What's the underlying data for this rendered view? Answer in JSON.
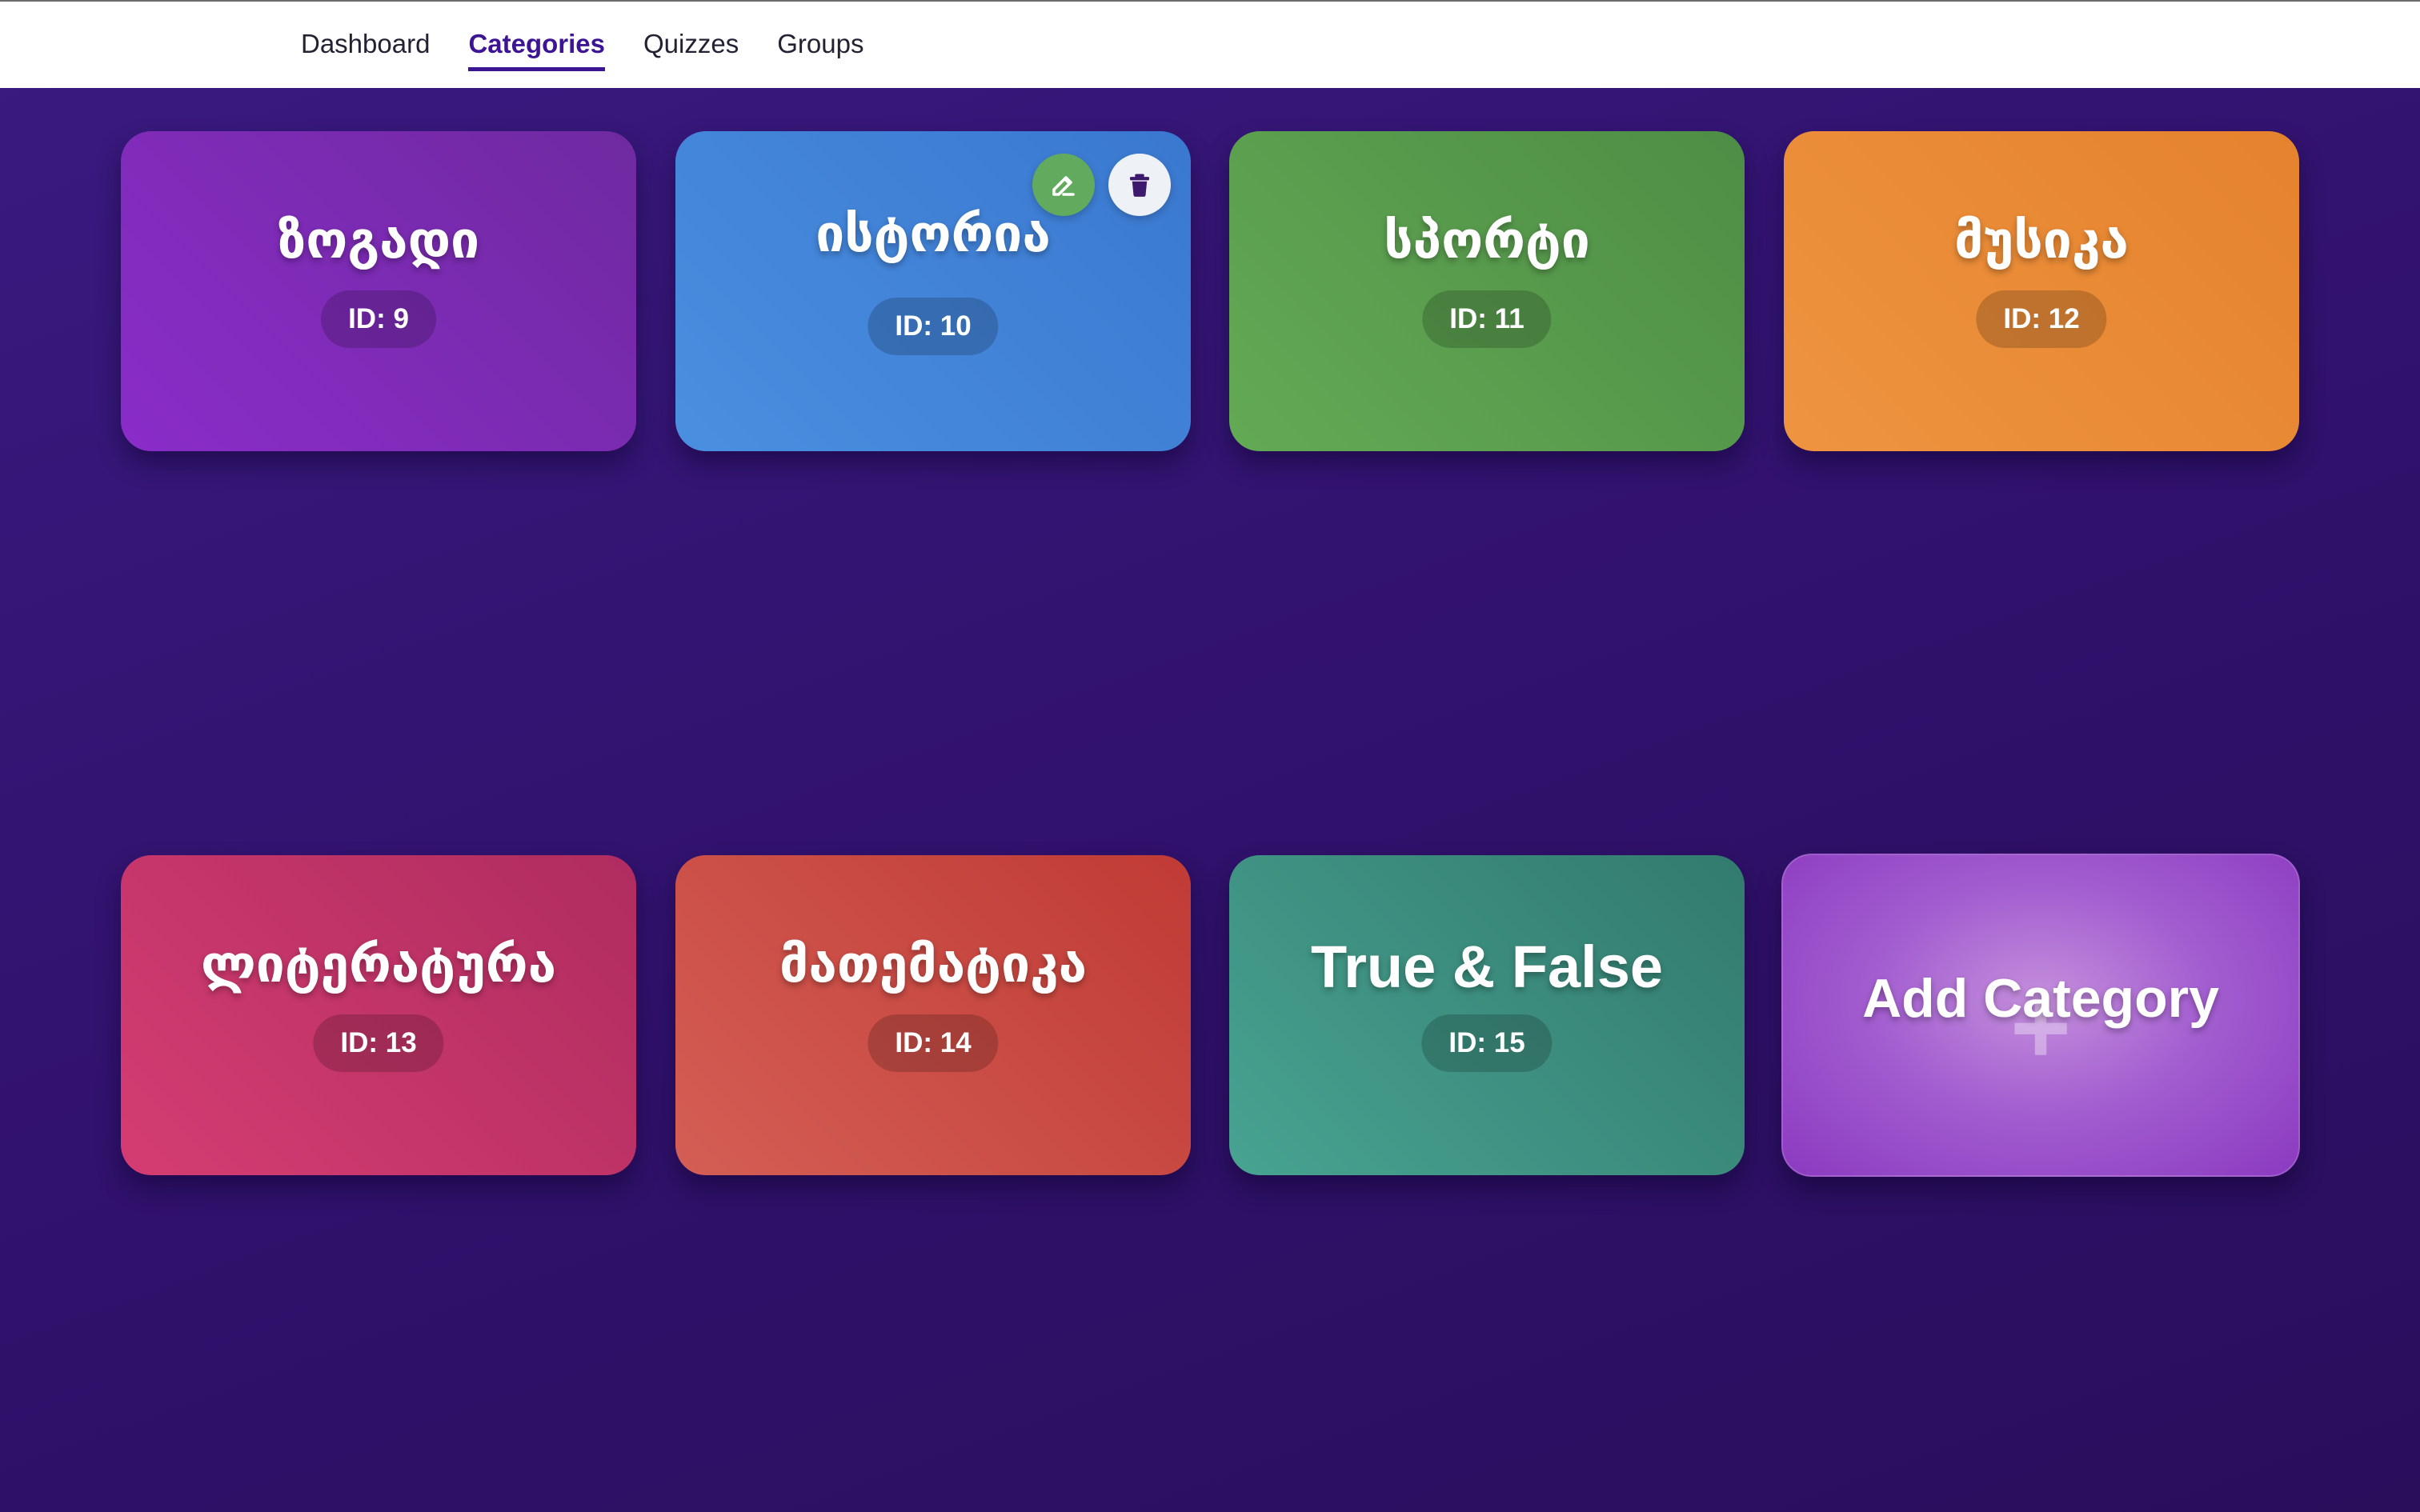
{
  "nav": {
    "items": [
      {
        "label": "Dashboard"
      },
      {
        "label": "Categories"
      },
      {
        "label": "Quizzes"
      },
      {
        "label": "Groups"
      }
    ],
    "active": "Categories"
  },
  "categories": [
    {
      "name": "ზოგადი",
      "id_label": "ID: 9",
      "color_start": "#8a2cc9",
      "color_end": "#6f2aa0"
    },
    {
      "name": "ისტორია",
      "id_label": "ID: 10",
      "color_start": "#4a8fe0",
      "color_end": "#3a78d0"
    },
    {
      "name": "სპორტი",
      "id_label": "ID: 11",
      "color_start": "#63aa55",
      "color_end": "#4e8d45"
    },
    {
      "name": "მუსიკა",
      "id_label": "ID: 12",
      "color_start": "#ee9440",
      "color_end": "#e5822d"
    },
    {
      "name": "ლიტერატურა",
      "id_label": "ID: 13",
      "color_start": "#d43d72",
      "color_end": "#b02c5f"
    },
    {
      "name": "მათემატიკა",
      "id_label": "ID: 14",
      "color_start": "#d45e55",
      "color_end": "#c03b35"
    },
    {
      "name": "True & False",
      "id_label": "ID: 15",
      "color_start": "#48a391",
      "color_end": "#327a6e"
    }
  ],
  "add_card": {
    "label": "Add Category",
    "plus": "+"
  },
  "hover_actions": {
    "card_index": 1,
    "edit_icon": "pencil-icon",
    "delete_icon": "trash-icon"
  }
}
